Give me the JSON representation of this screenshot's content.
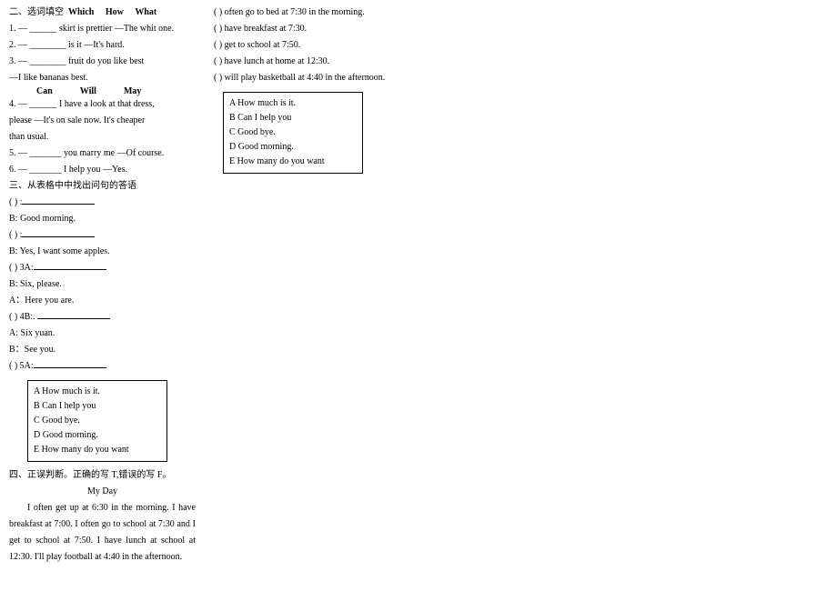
{
  "sec2": {
    "title": "二、选词填空",
    "words1": [
      "Which",
      "How",
      "What"
    ],
    "q1": "1. — ______ skirt is prettier —The whit one.",
    "q2": "2. — ________ is it  —It's hard.",
    "q3a": "3. — ________ fruit do you like best",
    "q3b": "—I like bananas best.",
    "words2": [
      "Can",
      "Will",
      "May"
    ],
    "q4a": "4. — ______ I have a look at that dress,",
    "q4b": "please —It's on sale now. It's cheaper",
    "q4c": "than usual.",
    "q5": "5. — _______ you marry me   —Of course.",
    "q6": "6. — _______ I help you    —Yes."
  },
  "sec3": {
    "title": "三、从表格中中找出问句的答语",
    "l1": "(   ) :",
    "l2": "B: Good morning.",
    "l3": "(   ) :",
    "l4": "B: Yes, I want some apples.",
    "l5": "(   ) 3A:",
    "l6": "B: Six, please.",
    "l7": "A：Here you are.",
    "l8": "(   ) 4B:.",
    "l9": "A: Six yuan.",
    "l10": "B：See you.",
    "l11": "(   ) 5A:",
    "boxA": "A How much is it.",
    "boxB": "B Can I help you",
    "boxC": "C Good bye.",
    "boxD": "D Good morning.",
    "boxE": "E How many do you want"
  },
  "sec4": {
    "title": "四、正误判断。正确的写 T,错误的写 F。",
    "ptitle": "My Day",
    "p1": "I often get up at 6:30 in the morning. I have breakfast at 7:00. I often go to school at 7:30 and I get to school at 7:50. I have lunch at school at 12:30. I'll play football at 4:40 in the afternoon.",
    "q1": "(   ) often go to bed at 7:30 in the morning.",
    "q2": "(   ) have breakfast at 7:30.",
    "q3": "(   ) get to school at 7:50.",
    "q4": "(   ) have lunch at home at 12:30.",
    "q5": "(   ) will play basketball at 4:40 in the afternoon."
  }
}
